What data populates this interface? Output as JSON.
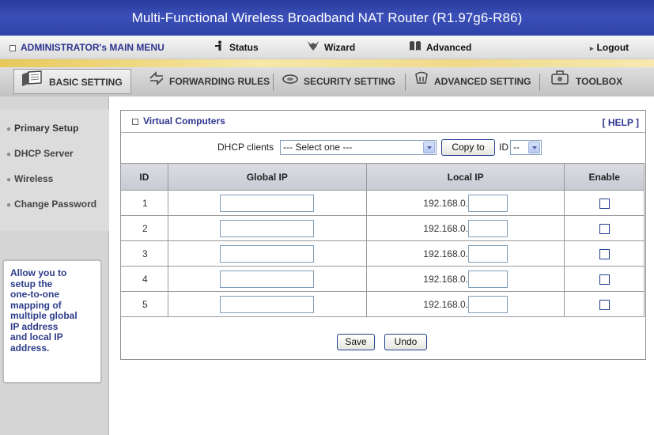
{
  "title": "Multi-Functional Wireless Broadband NAT Router (R1.97g6-R86)",
  "menu": {
    "main_menu": "ADMINISTRATOR's MAIN MENU",
    "status": "Status",
    "wizard": "Wizard",
    "advanced": "Advanced",
    "logout": "Logout"
  },
  "tabs": {
    "basic": "BASIC SETTING",
    "forwarding": "FORWARDING RULES",
    "security": "SECURITY SETTING",
    "advanced": "ADVANCED SETTING",
    "toolbox": "TOOLBOX"
  },
  "sidebar": {
    "items": [
      "Primary Setup",
      "DHCP Server",
      "Wireless",
      "Change Password"
    ],
    "help_text": [
      "Allow you to",
      "setup the",
      "one-to-one",
      "mapping of",
      "multiple global",
      "IP address",
      "and local IP",
      "address."
    ]
  },
  "panel": {
    "title": "Virtual Computers",
    "help_link": "[ HELP ]",
    "dhcp_label": "DHCP clients",
    "dhcp_select": "--- Select one ---",
    "copy_button": "Copy to",
    "id_label": "ID",
    "id_select": "--"
  },
  "table": {
    "headers": {
      "id": "ID",
      "global_ip": "Global IP",
      "local_ip": "Local IP",
      "enable": "Enable"
    },
    "local_prefix": "192.168.0.",
    "rows": [
      "1",
      "2",
      "3",
      "4",
      "5"
    ]
  },
  "actions": {
    "save": "Save",
    "undo": "Undo"
  }
}
